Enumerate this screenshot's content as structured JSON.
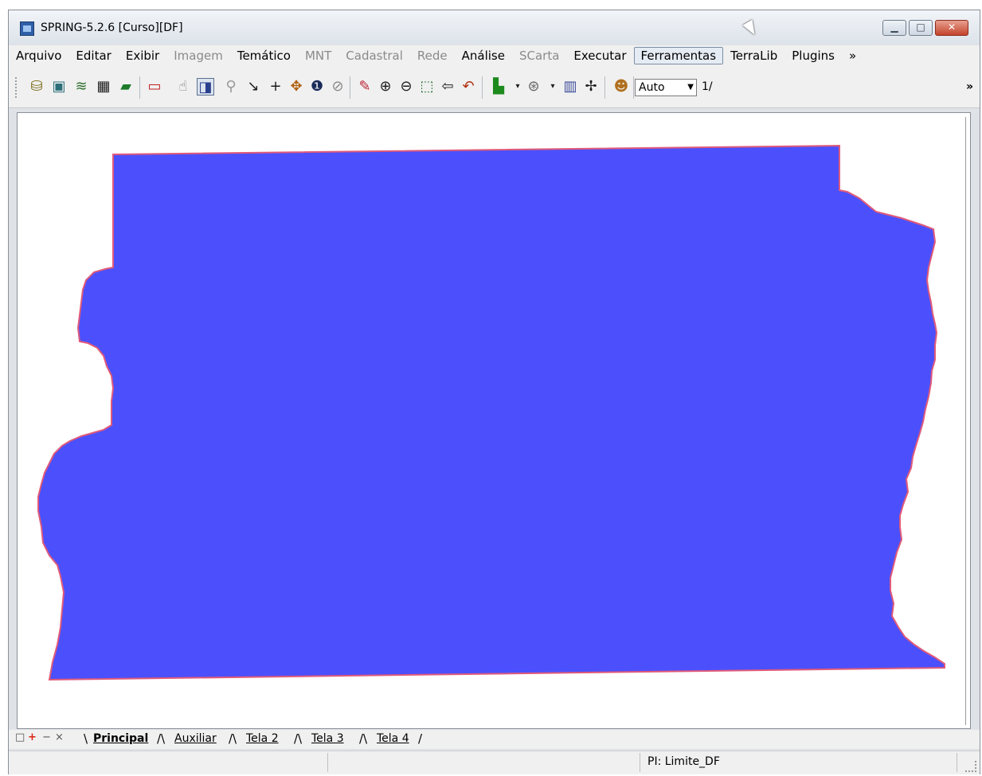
{
  "window": {
    "title": "SPRING-5.2.6 [Curso][DF]",
    "buttons": {
      "minimize": "▁",
      "maximize": "□",
      "close": "✕"
    }
  },
  "menu": [
    {
      "label": "Arquivo",
      "enabled": true
    },
    {
      "label": "Editar",
      "enabled": true
    },
    {
      "label": "Exibir",
      "enabled": true
    },
    {
      "label": "Imagem",
      "enabled": false
    },
    {
      "label": "Temático",
      "enabled": true
    },
    {
      "label": "MNT",
      "enabled": false
    },
    {
      "label": "Cadastral",
      "enabled": false
    },
    {
      "label": "Rede",
      "enabled": false
    },
    {
      "label": "Análise",
      "enabled": true
    },
    {
      "label": "SCarta",
      "enabled": false
    },
    {
      "label": "Executar",
      "enabled": true
    },
    {
      "label": "Ferramentas",
      "enabled": true,
      "active": true
    },
    {
      "label": "TerraLib",
      "enabled": true
    },
    {
      "label": "Plugins",
      "enabled": true
    },
    {
      "label": "»",
      "enabled": true
    }
  ],
  "toolbar": {
    "icons": [
      "database-icon",
      "image-icon",
      "layers-icon",
      "grid-icon",
      "plane-icon",
      "window-icon",
      "cursor-icon",
      "select-mode-icon",
      "search-icon",
      "arrow-down-right-icon",
      "plus-icon",
      "move-icon",
      "info-icon",
      "no-icon",
      "pencil-icon",
      "zoom-in-icon",
      "zoom-out-icon",
      "zoom-area-icon",
      "back-icon",
      "undo-icon",
      "green-layer-icon",
      "measure-icon",
      "histogram-icon",
      "star-icon",
      "palette-icon"
    ],
    "scale_select": "Auto",
    "scale_value": "1/",
    "more": "»"
  },
  "canvas": {
    "fill_color": "#4b50fc",
    "stroke_color": "#e05a7a"
  },
  "tabs": {
    "controls": [
      "□",
      "+",
      "−",
      "×"
    ],
    "items": [
      "Principal",
      "Auxiliar",
      "Tela 2",
      "Tela 3",
      "Tela 4"
    ],
    "active": "Principal"
  },
  "status": {
    "pi": "PI: Limite_DF"
  }
}
